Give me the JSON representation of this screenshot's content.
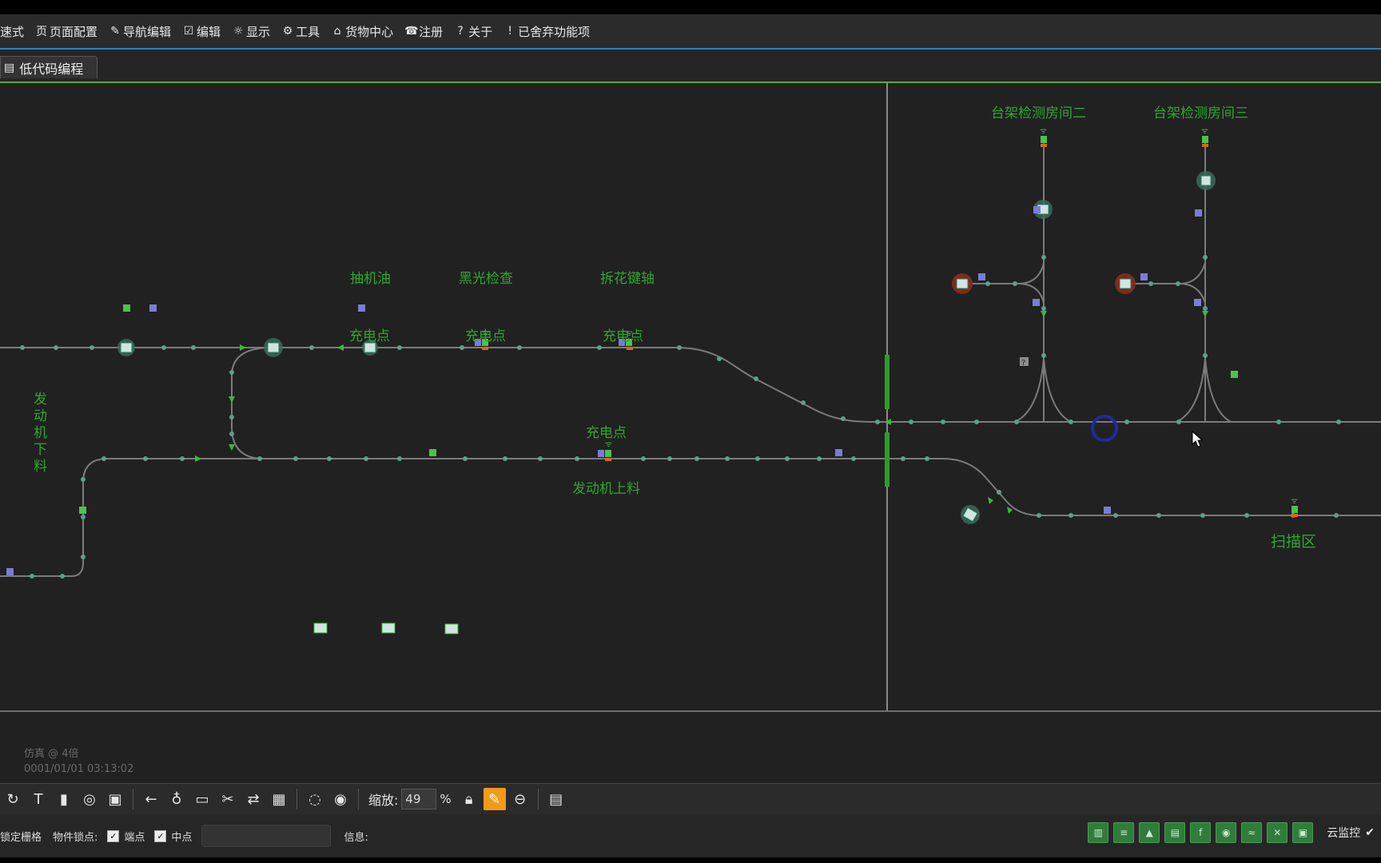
{
  "menu": {
    "items": [
      {
        "icon": "",
        "label": "速式"
      },
      {
        "icon": "页",
        "label": "页面配置"
      },
      {
        "icon": "✎",
        "label": "导航编辑"
      },
      {
        "icon": "☑",
        "label": "编辑"
      },
      {
        "icon": "☼",
        "label": "显示"
      },
      {
        "icon": "⚙",
        "label": "工具"
      },
      {
        "icon": "⌂",
        "label": "货物中心"
      },
      {
        "icon": "☎",
        "label": "注册"
      },
      {
        "icon": "?",
        "label": "关于"
      },
      {
        "icon": "!",
        "label": "已舍弃功能项"
      }
    ]
  },
  "tab": {
    "label": "低代码编程"
  },
  "map": {
    "labels": {
      "pump_oil": "抽机油",
      "black_light": "黑光检查",
      "disassemble": "拆花键轴",
      "charge1": "充电点",
      "charge2": "充电点",
      "charge3": "充电点",
      "charge4": "充电点",
      "engine_unload": "发动机下料",
      "engine_load": "发动机上料",
      "room2": "台架检测房间二",
      "room3": "台架检测房间三",
      "scan_area": "扫描区",
      "help_mark": "?"
    },
    "colors": {
      "track": "#7b7b7b",
      "label": "#2fa62f",
      "node": "#5e9e8b",
      "marker_e": "#4cc24c",
      "marker_a": "#7b7bd6"
    }
  },
  "sim": {
    "line1": "仿真 @ 4倍",
    "line2": "0001/01/01 03:13:02"
  },
  "toolbar": {
    "zoom_label": "缩放:",
    "zoom_value": "49",
    "zoom_unit": "%"
  },
  "status": {
    "grid": "锁定栅格",
    "snap": "物件锁点:",
    "endpoint": "端点",
    "midpoint": "中点",
    "info": "信息:",
    "cloud": "云监控"
  }
}
